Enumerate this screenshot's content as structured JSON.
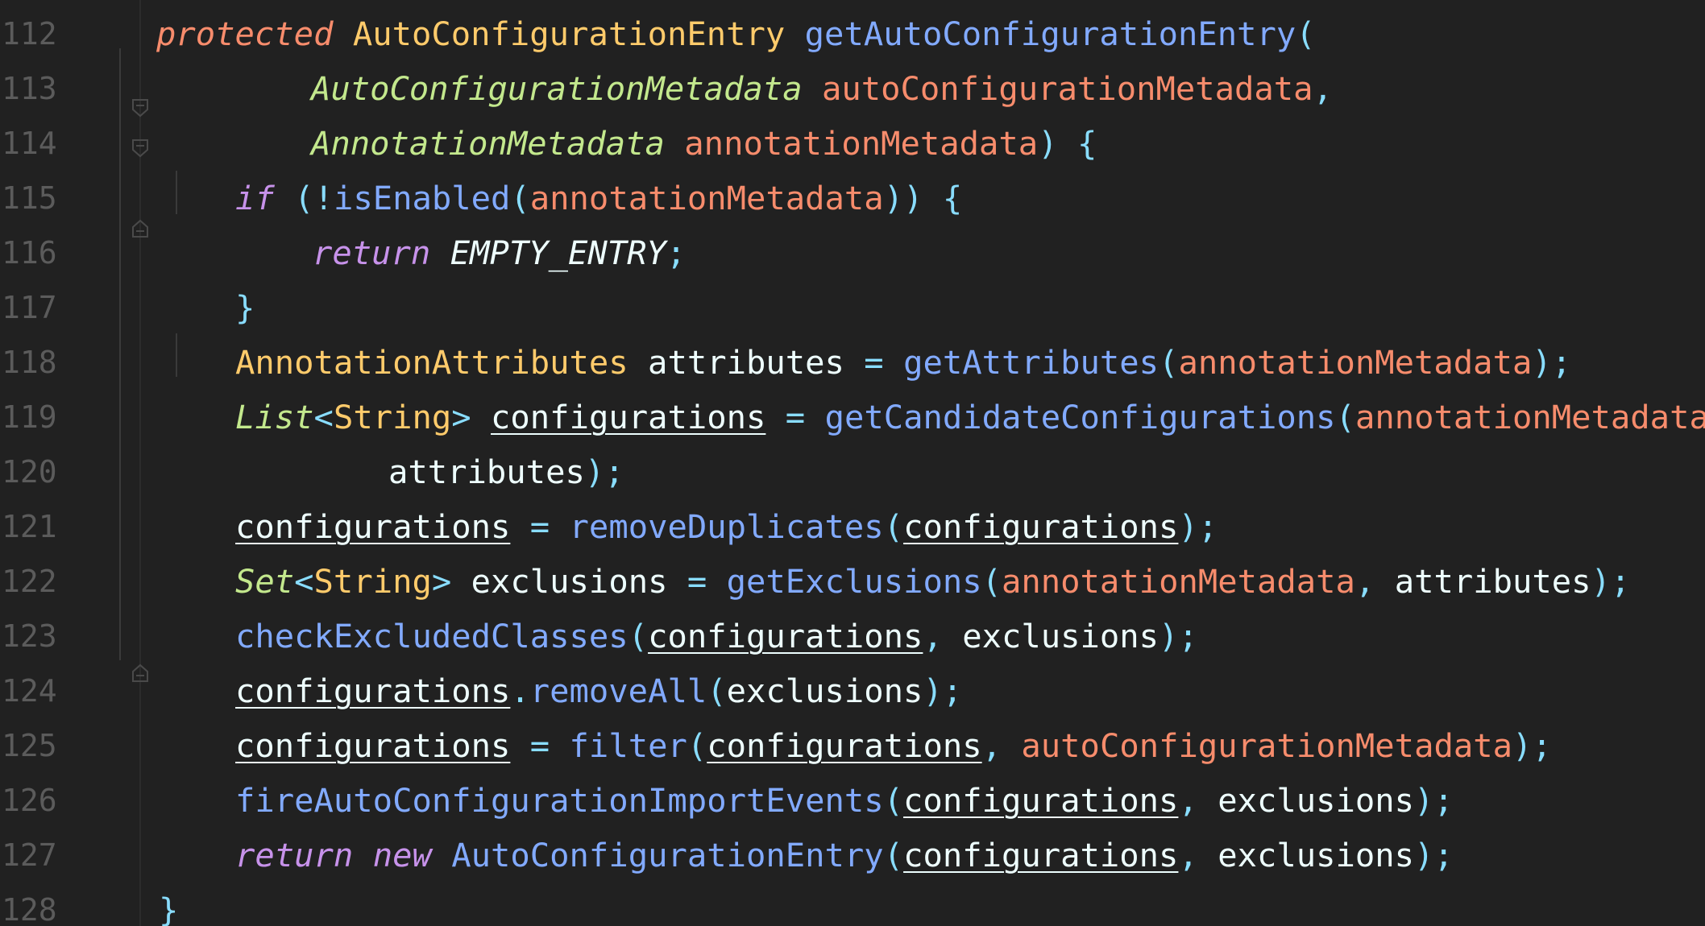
{
  "editor": {
    "lines": [
      {
        "number": "112",
        "tokens": [
          {
            "t": "protected",
            "c": "kw"
          },
          {
            "t": " ",
            "c": "plain"
          },
          {
            "t": "AutoConfigurationEntry",
            "c": "type"
          },
          {
            "t": " ",
            "c": "plain"
          },
          {
            "t": "getAutoConfigurationEntry",
            "c": "fn"
          },
          {
            "t": "(",
            "c": "punct"
          }
        ]
      },
      {
        "number": "113",
        "tokens": [
          {
            "t": "AutoConfigurationMetadata",
            "c": "itype"
          },
          {
            "t": " ",
            "c": "plain"
          },
          {
            "t": "autoConfigurationMetadata",
            "c": "param"
          },
          {
            "t": ",",
            "c": "punct"
          }
        ]
      },
      {
        "number": "114",
        "tokens": [
          {
            "t": "AnnotationMetadata",
            "c": "itype"
          },
          {
            "t": " ",
            "c": "plain"
          },
          {
            "t": "annotationMetadata",
            "c": "param"
          },
          {
            "t": ") {",
            "c": "punct"
          }
        ]
      },
      {
        "number": "115",
        "tokens": [
          {
            "t": "if",
            "c": "ctl"
          },
          {
            "t": " (!",
            "c": "punct"
          },
          {
            "t": "isEnabled",
            "c": "fn"
          },
          {
            "t": "(",
            "c": "punct"
          },
          {
            "t": "annotationMetadata",
            "c": "param"
          },
          {
            "t": ")) {",
            "c": "punct"
          }
        ]
      },
      {
        "number": "116",
        "tokens": [
          {
            "t": "return",
            "c": "ctl"
          },
          {
            "t": " ",
            "c": "plain"
          },
          {
            "t": "EMPTY_ENTRY",
            "c": "const"
          },
          {
            "t": ";",
            "c": "punct"
          }
        ]
      },
      {
        "number": "117",
        "tokens": [
          {
            "t": "}",
            "c": "punct"
          }
        ]
      },
      {
        "number": "118",
        "tokens": [
          {
            "t": "AnnotationAttributes",
            "c": "type"
          },
          {
            "t": " attributes ",
            "c": "plain"
          },
          {
            "t": "=",
            "c": "punct"
          },
          {
            "t": " ",
            "c": "plain"
          },
          {
            "t": "getAttributes",
            "c": "fn"
          },
          {
            "t": "(",
            "c": "punct"
          },
          {
            "t": "annotationMetadata",
            "c": "param"
          },
          {
            "t": ");",
            "c": "punct"
          }
        ]
      },
      {
        "number": "119",
        "tokens": [
          {
            "t": "List",
            "c": "itype"
          },
          {
            "t": "<",
            "c": "punct"
          },
          {
            "t": "String",
            "c": "type"
          },
          {
            "t": ">",
            "c": "punct"
          },
          {
            "t": " ",
            "c": "plain"
          },
          {
            "t": "configurations",
            "c": "var"
          },
          {
            "t": " ",
            "c": "plain"
          },
          {
            "t": "=",
            "c": "punct"
          },
          {
            "t": " ",
            "c": "plain"
          },
          {
            "t": "getCandidateConfigurations",
            "c": "fn"
          },
          {
            "t": "(",
            "c": "punct"
          },
          {
            "t": "annotationMetadata",
            "c": "param"
          },
          {
            "t": ",",
            "c": "punct"
          }
        ]
      },
      {
        "number": "120",
        "tokens": [
          {
            "t": "attributes",
            "c": "plain"
          },
          {
            "t": ");",
            "c": "punct"
          }
        ]
      },
      {
        "number": "121",
        "tokens": [
          {
            "t": "configurations",
            "c": "var"
          },
          {
            "t": " ",
            "c": "plain"
          },
          {
            "t": "=",
            "c": "punct"
          },
          {
            "t": " ",
            "c": "plain"
          },
          {
            "t": "removeDuplicates",
            "c": "fn"
          },
          {
            "t": "(",
            "c": "punct"
          },
          {
            "t": "configurations",
            "c": "var"
          },
          {
            "t": ");",
            "c": "punct"
          }
        ]
      },
      {
        "number": "122",
        "tokens": [
          {
            "t": "Set",
            "c": "itype"
          },
          {
            "t": "<",
            "c": "punct"
          },
          {
            "t": "String",
            "c": "type"
          },
          {
            "t": ">",
            "c": "punct"
          },
          {
            "t": " exclusions ",
            "c": "plain"
          },
          {
            "t": "=",
            "c": "punct"
          },
          {
            "t": " ",
            "c": "plain"
          },
          {
            "t": "getExclusions",
            "c": "fn"
          },
          {
            "t": "(",
            "c": "punct"
          },
          {
            "t": "annotationMetadata",
            "c": "param"
          },
          {
            "t": ",",
            "c": "punct"
          },
          {
            "t": " attributes",
            "c": "plain"
          },
          {
            "t": ");",
            "c": "punct"
          }
        ]
      },
      {
        "number": "123",
        "tokens": [
          {
            "t": "checkExcludedClasses",
            "c": "fn"
          },
          {
            "t": "(",
            "c": "punct"
          },
          {
            "t": "configurations",
            "c": "var"
          },
          {
            "t": ",",
            "c": "punct"
          },
          {
            "t": " exclusions",
            "c": "plain"
          },
          {
            "t": ");",
            "c": "punct"
          }
        ]
      },
      {
        "number": "124",
        "tokens": [
          {
            "t": "configurations",
            "c": "var"
          },
          {
            "t": ".",
            "c": "punct"
          },
          {
            "t": "removeAll",
            "c": "fn"
          },
          {
            "t": "(",
            "c": "punct"
          },
          {
            "t": "exclusions",
            "c": "plain"
          },
          {
            "t": ");",
            "c": "punct"
          }
        ]
      },
      {
        "number": "125",
        "tokens": [
          {
            "t": "configurations",
            "c": "var"
          },
          {
            "t": " ",
            "c": "plain"
          },
          {
            "t": "=",
            "c": "punct"
          },
          {
            "t": " ",
            "c": "plain"
          },
          {
            "t": "filter",
            "c": "fn"
          },
          {
            "t": "(",
            "c": "punct"
          },
          {
            "t": "configurations",
            "c": "var"
          },
          {
            "t": ",",
            "c": "punct"
          },
          {
            "t": " ",
            "c": "plain"
          },
          {
            "t": "autoConfigurationMetadata",
            "c": "param"
          },
          {
            "t": ");",
            "c": "punct"
          }
        ]
      },
      {
        "number": "126",
        "tokens": [
          {
            "t": "fireAutoConfigurationImportEvents",
            "c": "fn"
          },
          {
            "t": "(",
            "c": "punct"
          },
          {
            "t": "configurations",
            "c": "var"
          },
          {
            "t": ",",
            "c": "punct"
          },
          {
            "t": " exclusions",
            "c": "plain"
          },
          {
            "t": ");",
            "c": "punct"
          }
        ]
      },
      {
        "number": "127",
        "tokens": [
          {
            "t": "return",
            "c": "ctl"
          },
          {
            "t": " ",
            "c": "plain"
          },
          {
            "t": "new",
            "c": "ctl"
          },
          {
            "t": " ",
            "c": "plain"
          },
          {
            "t": "AutoConfigurationEntry",
            "c": "fn"
          },
          {
            "t": "(",
            "c": "punct"
          },
          {
            "t": "configurations",
            "c": "var"
          },
          {
            "t": ",",
            "c": "punct"
          },
          {
            "t": " exclusions",
            "c": "plain"
          },
          {
            "t": ");",
            "c": "punct"
          }
        ]
      },
      {
        "number": "128",
        "tokens": [
          {
            "t": "}",
            "c": "punct"
          }
        ]
      }
    ]
  },
  "colors": {
    "background": "#212121",
    "line_number": "#5b5b5b",
    "keyword": "#f78c6c",
    "control": "#c792ea",
    "type": "#ffcb6b",
    "italic_type": "#c3e88d",
    "function": "#82aaff",
    "parameter": "#f78c6c",
    "punctuation": "#89ddff",
    "plain": "#eeffff"
  }
}
